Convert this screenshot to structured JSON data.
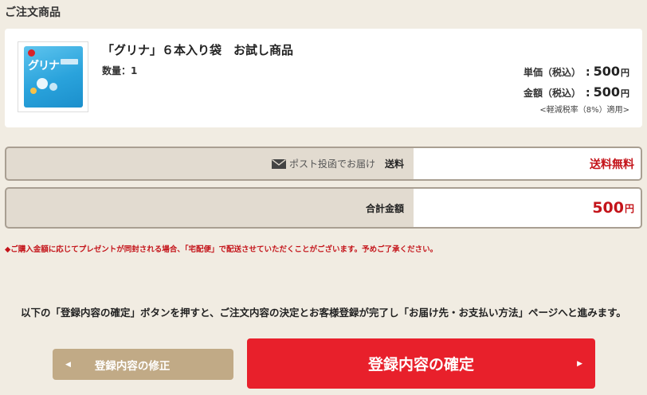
{
  "order": {
    "section_title": "ご注文商品",
    "item": {
      "thumbnail_brand": "グリナ",
      "name": "「グリナ」６本入り袋　お試し商品",
      "quantity": "数量：1",
      "unit_price_label": "単価（税込）",
      "unit_price_value": "500",
      "total_label": "金額（税込）",
      "total_value": "500",
      "currency": "円",
      "tax_note": "<軽減税率（8%）適用>"
    },
    "shipping": {
      "icon": "envelope-icon",
      "method": "ポスト投函でお届け",
      "label": "送料",
      "value": "送料無料"
    },
    "grand_total": {
      "label": "合計金額",
      "value": "500",
      "currency": "円"
    },
    "notice": "◆ご購入金額に応じてプレゼントが同封される場合、「宅配便」で配送させていただくことがございます。予めご了承ください。",
    "guide": "以下の「登録内容の確定」ボタンを押すと、ご注文内容の決定とお客様登録が完了し「お届け先・お支払い方法」ページへと進みます。"
  },
  "actions": {
    "back_label": "登録内容の修正",
    "back_icon": "left-triangle-icon",
    "confirm_label": "登録内容の確定",
    "confirm_icon": "right-triangle-icon"
  },
  "colors": {
    "background": "#f1ece2",
    "accent_red": "#e8202b",
    "price_red": "#c4141a",
    "back_button": "#c1aa86"
  }
}
